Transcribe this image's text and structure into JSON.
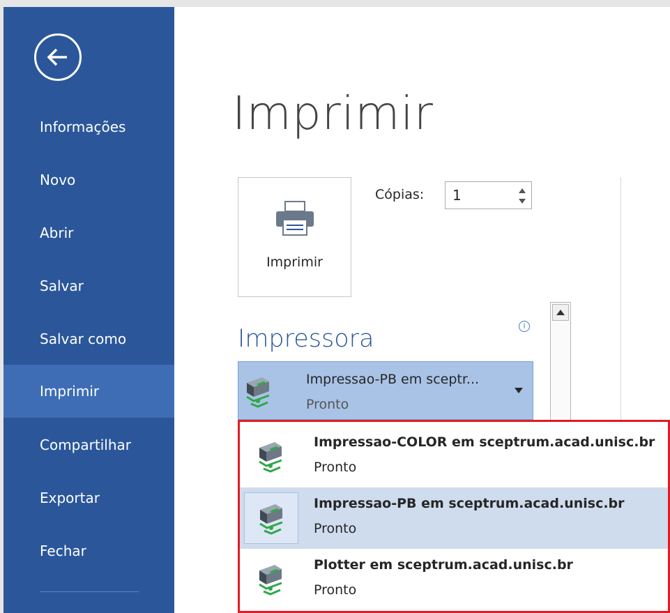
{
  "sidebar": {
    "back_label": "",
    "items": [
      {
        "label": "Informações"
      },
      {
        "label": "Novo"
      },
      {
        "label": "Abrir"
      },
      {
        "label": "Salvar"
      },
      {
        "label": "Salvar como"
      },
      {
        "label": "Imprimir",
        "active": true
      },
      {
        "label": "Compartilhar"
      },
      {
        "label": "Exportar"
      },
      {
        "label": "Fechar"
      }
    ]
  },
  "main": {
    "title": "Imprimir",
    "print_button_label": "Imprimir",
    "copies_label": "Cópias:",
    "copies_value": "1",
    "printer_section_title": "Impressora",
    "info_icon": "i"
  },
  "printer": {
    "selected_name": "Impressao-PB em sceptr...",
    "selected_status": "Pronto"
  },
  "dropdown": {
    "options": [
      {
        "name": "Impressao-COLOR em sceptrum.acad.unisc.br",
        "status": "Pronto"
      },
      {
        "name": "Impressao-PB em sceptrum.acad.unisc.br",
        "status": "Pronto",
        "hover": true
      },
      {
        "name": "Plotter em sceptrum.acad.unisc.br",
        "status": "Pronto"
      }
    ]
  },
  "colors": {
    "sidebar": "#2b579a",
    "sidebar_active": "#3e6db5",
    "accent": "#2b579a",
    "dropdown_border": "#e21b24",
    "selected_bg": "#a9c3e6"
  },
  "icons": [
    "back-arrow-icon",
    "printer-icon",
    "network-printer-icon",
    "info-icon",
    "chevron-down-icon",
    "spin-up-icon",
    "spin-down-icon",
    "scroll-up-icon"
  ]
}
